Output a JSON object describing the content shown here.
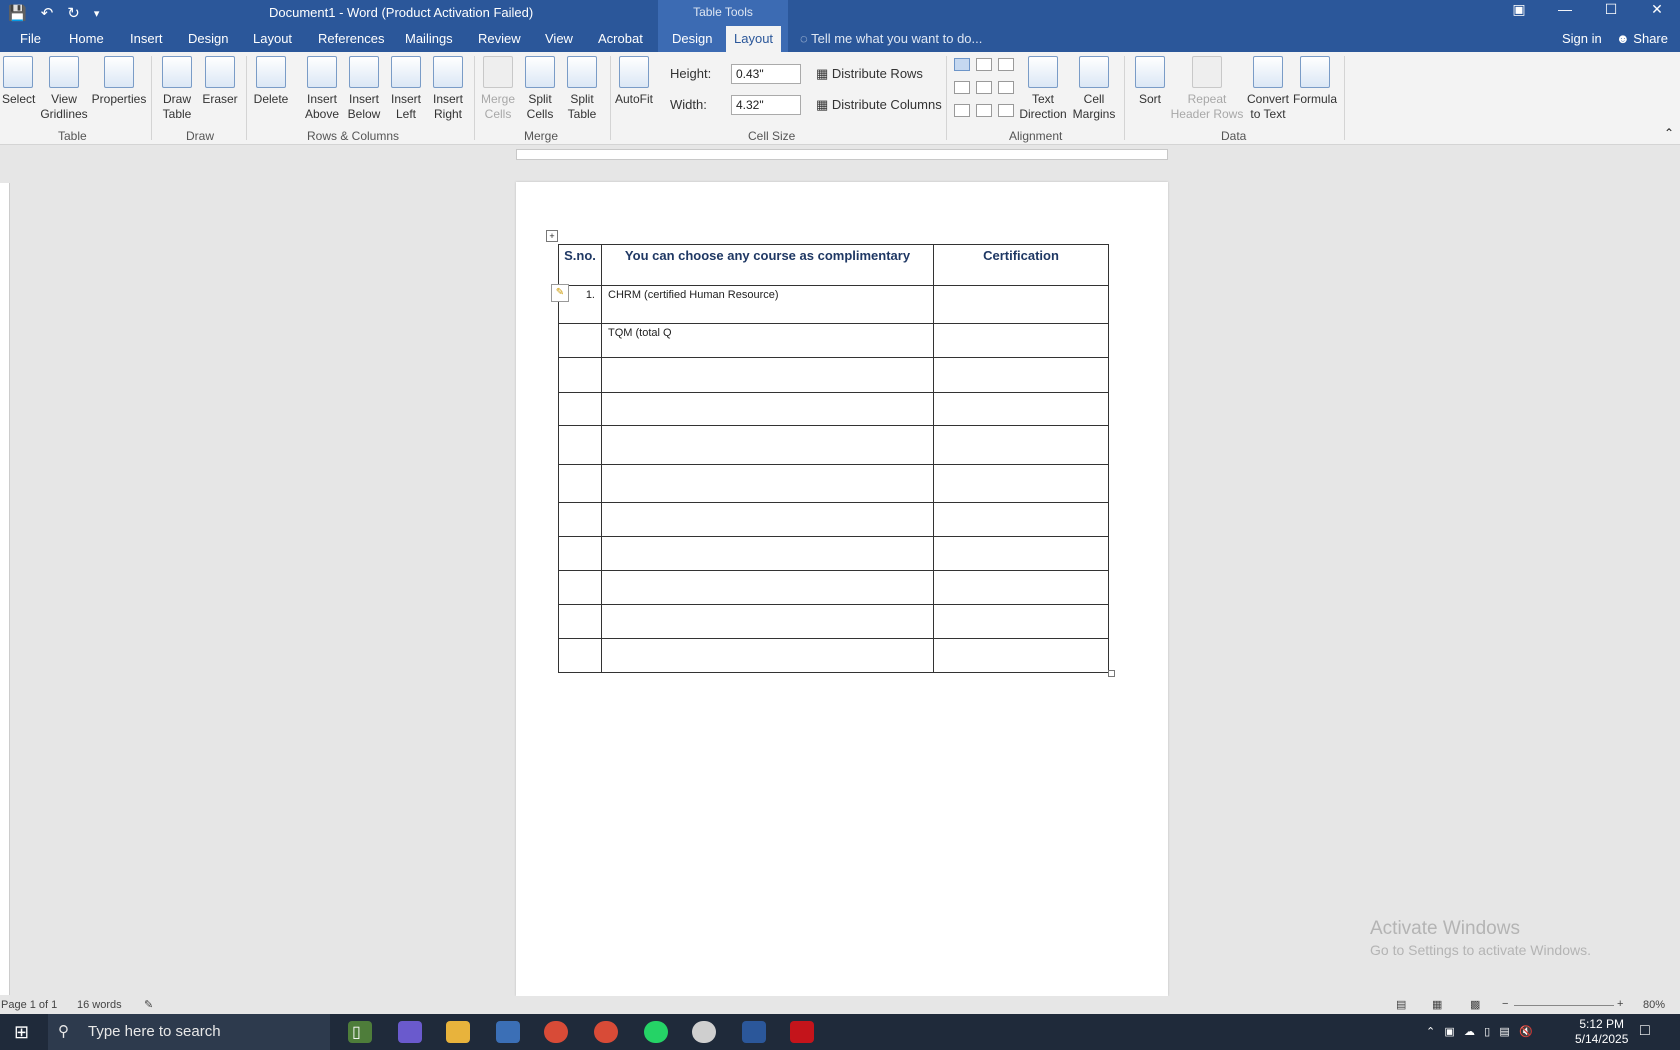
{
  "window": {
    "title": "Document1 - Word (Product Activation Failed)",
    "context_tab_group": "Table Tools"
  },
  "tabs": [
    "File",
    "Home",
    "Insert",
    "Design",
    "Layout",
    "References",
    "Mailings",
    "Review",
    "View",
    "Acrobat",
    "Design",
    "Layout"
  ],
  "tell_me": "Tell me what you want to do...",
  "account": {
    "sign_in": "Sign in",
    "share": "Share"
  },
  "ribbon": {
    "table_group": {
      "label": "Table",
      "select": "Select",
      "view_gridlines_1": "View",
      "view_gridlines_2": "Gridlines",
      "properties": "Properties"
    },
    "draw_group": {
      "label": "Draw",
      "draw_table_1": "Draw",
      "draw_table_2": "Table",
      "eraser": "Eraser"
    },
    "rows_columns_group": {
      "label": "Rows & Columns",
      "delete": "Delete",
      "insert_above_1": "Insert",
      "insert_above_2": "Above",
      "insert_below_1": "Insert",
      "insert_below_2": "Below",
      "insert_left_1": "Insert",
      "insert_left_2": "Left",
      "insert_right_1": "Insert",
      "insert_right_2": "Right"
    },
    "merge_group": {
      "label": "Merge",
      "merge_cells_1": "Merge",
      "merge_cells_2": "Cells",
      "split_cells_1": "Split",
      "split_cells_2": "Cells",
      "split_table_1": "Split",
      "split_table_2": "Table"
    },
    "cell_size_group": {
      "label": "Cell Size",
      "autofit": "AutoFit",
      "height_label": "Height:",
      "height_value": "0.43\"",
      "width_label": "Width:",
      "width_value": "4.32\"",
      "distribute_rows": "Distribute Rows",
      "distribute_columns": "Distribute Columns"
    },
    "alignment_group": {
      "label": "Alignment",
      "text_direction_1": "Text",
      "text_direction_2": "Direction",
      "cell_margins_1": "Cell",
      "cell_margins_2": "Margins"
    },
    "data_group": {
      "label": "Data",
      "sort": "Sort",
      "repeat_header_1": "Repeat",
      "repeat_header_2": "Header Rows",
      "convert_1": "Convert",
      "convert_2": "to Text",
      "formula": "Formula"
    }
  },
  "document_table": {
    "headers": [
      "S.no.",
      "You can choose any course as complimentary",
      "Certification"
    ],
    "rows": [
      [
        "1.",
        "CHRM (certified Human Resource)",
        ""
      ],
      [
        "",
        "TQM (total Q",
        ""
      ],
      [
        "",
        "",
        ""
      ],
      [
        "",
        "",
        ""
      ],
      [
        "",
        "",
        ""
      ],
      [
        "",
        "",
        ""
      ],
      [
        "",
        "",
        ""
      ],
      [
        "",
        "",
        ""
      ],
      [
        "",
        "",
        ""
      ],
      [
        "",
        "",
        ""
      ],
      [
        "",
        "",
        ""
      ]
    ]
  },
  "watermark": {
    "line1": "Activate Windows",
    "line2": "Go to Settings to activate Windows."
  },
  "status": {
    "page": "Page 1 of 1",
    "words": "16 words",
    "zoom": "80%"
  },
  "taskbar": {
    "search_placeholder": "Type here to search",
    "time": "5:12 PM",
    "date": "5/14/2025"
  }
}
